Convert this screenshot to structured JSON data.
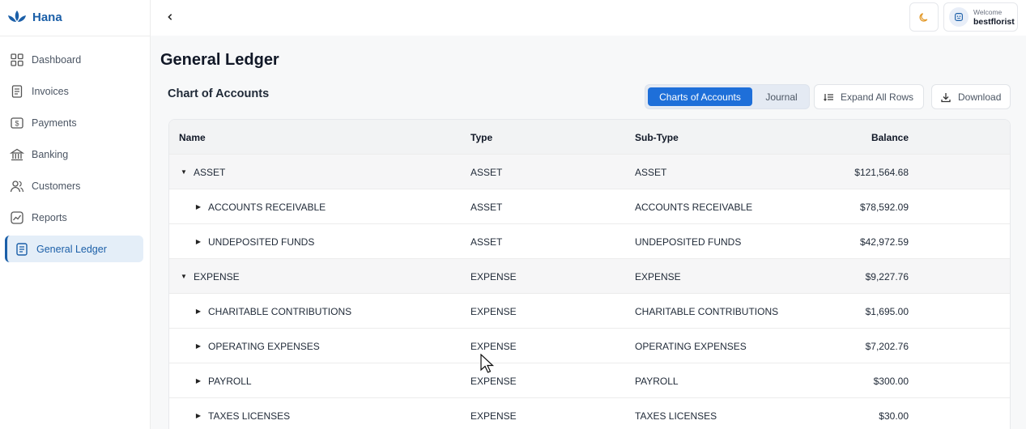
{
  "app": {
    "name": "Hana",
    "brand_color": "#1b5fa8",
    "accent_color": "#1e6fd9"
  },
  "sidebar": {
    "items": [
      {
        "label": "Dashboard",
        "icon": "grid-icon",
        "active": false
      },
      {
        "label": "Invoices",
        "icon": "document-icon",
        "active": false
      },
      {
        "label": "Payments",
        "icon": "dollar-icon",
        "active": false
      },
      {
        "label": "Banking",
        "icon": "bank-icon",
        "active": false
      },
      {
        "label": "Customers",
        "icon": "users-icon",
        "active": false
      },
      {
        "label": "Reports",
        "icon": "chart-line-icon",
        "active": false
      },
      {
        "label": "General Ledger",
        "icon": "ledger-icon",
        "active": true
      }
    ]
  },
  "header": {
    "back_icon": "chevron-left-icon",
    "theme_icon": "moon-icon",
    "welcome": "Welcome",
    "username": "bestflorist"
  },
  "page": {
    "title": "General Ledger",
    "section_title": "Chart of Accounts",
    "view_toggle": {
      "active": "Charts of Accounts",
      "inactive": "Journal"
    },
    "expand_label": "Expand All Rows",
    "download_label": "Download"
  },
  "table": {
    "columns": [
      "Name",
      "Type",
      "Sub-Type",
      "Balance"
    ],
    "rows": [
      {
        "level": "group",
        "expanded": true,
        "name": "ASSET",
        "type": "ASSET",
        "sub_type": "ASSET",
        "balance": "$121,564.68"
      },
      {
        "level": "child",
        "expanded": false,
        "name": "ACCOUNTS RECEIVABLE",
        "type": "ASSET",
        "sub_type": "ACCOUNTS RECEIVABLE",
        "balance": "$78,592.09"
      },
      {
        "level": "child",
        "expanded": false,
        "name": "UNDEPOSITED FUNDS",
        "type": "ASSET",
        "sub_type": "UNDEPOSITED FUNDS",
        "balance": "$42,972.59"
      },
      {
        "level": "group",
        "expanded": true,
        "name": "EXPENSE",
        "type": "EXPENSE",
        "sub_type": "EXPENSE",
        "balance": "$9,227.76"
      },
      {
        "level": "child",
        "expanded": false,
        "name": "CHARITABLE CONTRIBUTIONS",
        "type": "EXPENSE",
        "sub_type": "CHARITABLE CONTRIBUTIONS",
        "balance": "$1,695.00"
      },
      {
        "level": "child",
        "expanded": false,
        "name": "OPERATING EXPENSES",
        "type": "EXPENSE",
        "sub_type": "OPERATING EXPENSES",
        "balance": "$7,202.76"
      },
      {
        "level": "child",
        "expanded": false,
        "name": "PAYROLL",
        "type": "EXPENSE",
        "sub_type": "PAYROLL",
        "balance": "$300.00"
      },
      {
        "level": "child",
        "expanded": false,
        "name": "TAXES LICENSES",
        "type": "EXPENSE",
        "sub_type": "TAXES LICENSES",
        "balance": "$30.00"
      }
    ]
  }
}
